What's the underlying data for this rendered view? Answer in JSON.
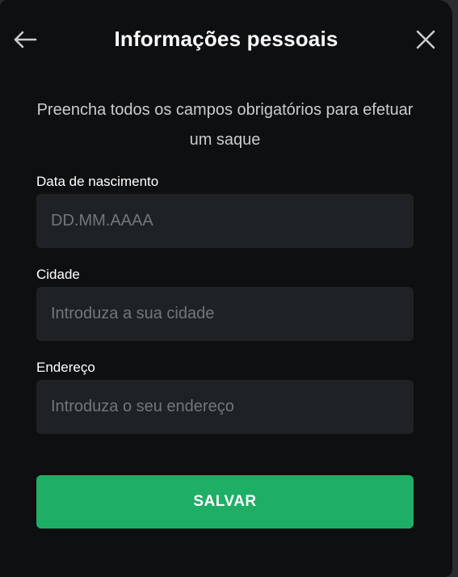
{
  "header": {
    "title": "Informações pessoais",
    "back_icon": "arrow-left-icon",
    "close_icon": "close-icon"
  },
  "subtitle": "Preencha todos os campos obrigatórios para efetuar um saque",
  "form": {
    "birthdate": {
      "label": "Data de nascimento",
      "value": "",
      "placeholder": "DD.MM.AAAA"
    },
    "city": {
      "label": "Cidade",
      "value": "",
      "placeholder": "Introduza a sua cidade"
    },
    "address": {
      "label": "Endereço",
      "value": "",
      "placeholder": "Introduza o seu endereço"
    }
  },
  "save_button": {
    "label": "SALVAR"
  },
  "colors": {
    "modal_background": "#0e0f11",
    "input_background": "#1f2225",
    "accent_green": "#1fae66",
    "text_primary": "#ffffff",
    "text_secondary": "#c9cbce",
    "placeholder": "#72767b"
  }
}
